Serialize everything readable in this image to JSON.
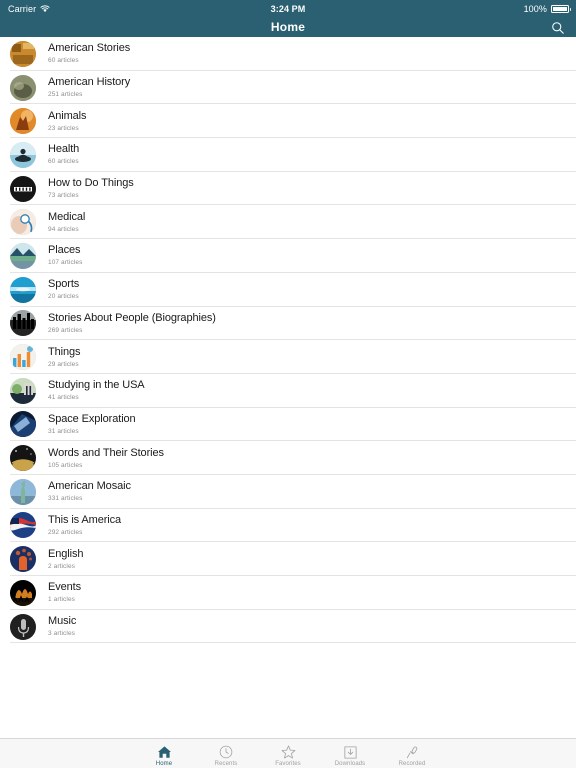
{
  "status_bar": {
    "carrier": "Carrier",
    "wifi_icon": "wifi-icon",
    "time": "3:24 PM",
    "battery_percent": "100%",
    "battery_icon": "battery-full-icon"
  },
  "nav_bar": {
    "title": "Home",
    "search_icon": "search-icon",
    "background_color": "#2a6072"
  },
  "list": {
    "items": [
      {
        "title": "American Stories",
        "subtitle": "60 articles",
        "thumb": "old-photo-sepia",
        "c1": "#c98a2e",
        "c2": "#7a4a12",
        "c3": "#e8c071"
      },
      {
        "title": "American History",
        "subtitle": "251 articles",
        "thumb": "bison-painting",
        "c1": "#8a9070",
        "c2": "#4f513c",
        "c3": "#b9b79a"
      },
      {
        "title": "Animals",
        "subtitle": "23 articles",
        "thumb": "deer-sunset",
        "c1": "#e08a2a",
        "c2": "#8c3d10",
        "c3": "#f5c277"
      },
      {
        "title": "Health",
        "subtitle": "60 articles",
        "thumb": "meditation-silhouette",
        "c1": "#8fc6dc",
        "c2": "#1d2b33",
        "c3": "#d8ecf4"
      },
      {
        "title": "How to Do Things",
        "subtitle": "73 articles",
        "thumb": "howto-black-badge",
        "c1": "#151515",
        "c2": "#000000",
        "c3": "#ffffff"
      },
      {
        "title": "Medical",
        "subtitle": "94 articles",
        "thumb": "stethoscope-hand",
        "c1": "#e9cbb8",
        "c2": "#2f7fb5",
        "c3": "#f6ece4"
      },
      {
        "title": "Places",
        "subtitle": "107 articles",
        "thumb": "mountain-lake",
        "c1": "#6fae8b",
        "c2": "#27516a",
        "c3": "#cfe6ea"
      },
      {
        "title": "Sports",
        "subtitle": "20 articles",
        "thumb": "swimmer-pool",
        "c1": "#1f9fd0",
        "c2": "#0d5f86",
        "c3": "#bfe6f4"
      },
      {
        "title": "Stories About People (Biographies)",
        "subtitle": "269 articles",
        "thumb": "city-skyline-dark",
        "c1": "#232323",
        "c2": "#000000",
        "c3": "#9aa2a6"
      },
      {
        "title": "Things",
        "subtitle": "29 articles",
        "thumb": "colorful-infographic",
        "c1": "#f3f1ec",
        "c2": "#ef8b32",
        "c3": "#3ea5d9"
      },
      {
        "title": "Studying in the USA",
        "subtitle": "41 articles",
        "thumb": "campus-green",
        "c1": "#7fae6a",
        "c2": "#1d2b3a",
        "c3": "#c9dcc0"
      },
      {
        "title": "Space Exploration",
        "subtitle": "31 articles",
        "thumb": "spacecraft-blue",
        "c1": "#1b3f73",
        "c2": "#0a1a33",
        "c3": "#9fc4e8"
      },
      {
        "title": "Words and Their Stories",
        "subtitle": "105 articles",
        "thumb": "dark-gold-book",
        "c1": "#141414",
        "c2": "#000000",
        "c3": "#c9a34a"
      },
      {
        "title": "American Mosaic",
        "subtitle": "331 articles",
        "thumb": "statue-of-liberty",
        "c1": "#8fb8d8",
        "c2": "#54748c",
        "c3": "#7fb59a"
      },
      {
        "title": "This is America",
        "subtitle": "292 articles",
        "thumb": "american-flag",
        "c1": "#1c3f86",
        "c2": "#0e2454",
        "c3": "#d8342f"
      },
      {
        "title": "English",
        "subtitle": "2 articles",
        "thumb": "head-thoughts-blue",
        "c1": "#1a2f63",
        "c2": "#0c1a3d",
        "c3": "#e2622b"
      },
      {
        "title": "Events",
        "subtitle": "1 articles",
        "thumb": "concert-crowd-fire",
        "c1": "#1a1005",
        "c2": "#000000",
        "c3": "#eb8b22"
      },
      {
        "title": "Music",
        "subtitle": "3 articles",
        "thumb": "microphone-dark",
        "c1": "#202020",
        "c2": "#000000",
        "c3": "#bdbdbd"
      }
    ]
  },
  "tab_bar": {
    "active_color": "#2a6072",
    "inactive_color": "#a0a0a0",
    "tabs": [
      {
        "label": "Home",
        "icon": "home-icon",
        "active": true
      },
      {
        "label": "Recents",
        "icon": "clock-icon",
        "active": false
      },
      {
        "label": "Favorites",
        "icon": "star-icon",
        "active": false
      },
      {
        "label": "Downloads",
        "icon": "download-icon",
        "active": false
      },
      {
        "label": "Recorded",
        "icon": "microphone-icon",
        "active": false
      }
    ]
  }
}
